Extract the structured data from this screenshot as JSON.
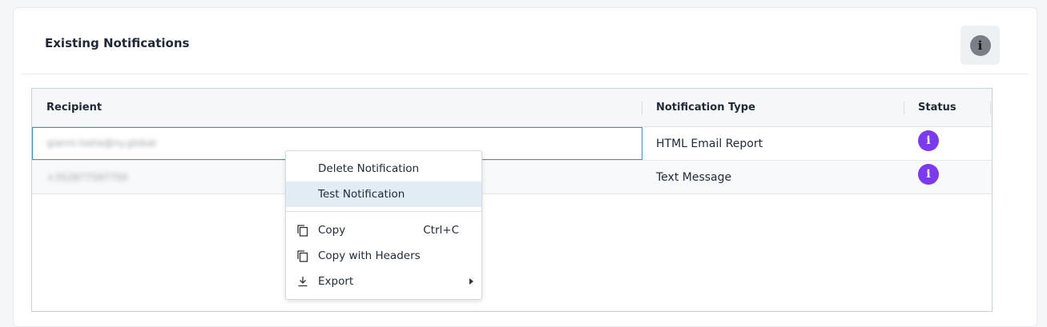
{
  "card": {
    "title": "Existing Notifications"
  },
  "header_actions": {
    "info_glyph": "i"
  },
  "grid": {
    "columns": [
      "Recipient",
      "Notification Type",
      "Status"
    ],
    "rows": [
      {
        "recipient": "gianni-loeta@ny.global",
        "type": "HTML Email Report",
        "status_icon": "info-icon",
        "status_glyph": "i"
      },
      {
        "recipient": "+352877597750",
        "type": "Text Message",
        "status_icon": "info-icon",
        "status_glyph": "i"
      }
    ]
  },
  "context_menu": {
    "items": [
      {
        "label": "Delete Notification"
      },
      {
        "label": "Test Notification"
      },
      {
        "label": "Copy",
        "shortcut": "Ctrl+C",
        "icon": "copy-icon"
      },
      {
        "label": "Copy with Headers",
        "icon": "copy-icon"
      },
      {
        "label": "Export",
        "icon": "download-icon"
      }
    ]
  },
  "colors": {
    "accent": "#7c3aed",
    "selection_border": "#3a8fd0",
    "menu_hover": "#e2ecf5"
  }
}
